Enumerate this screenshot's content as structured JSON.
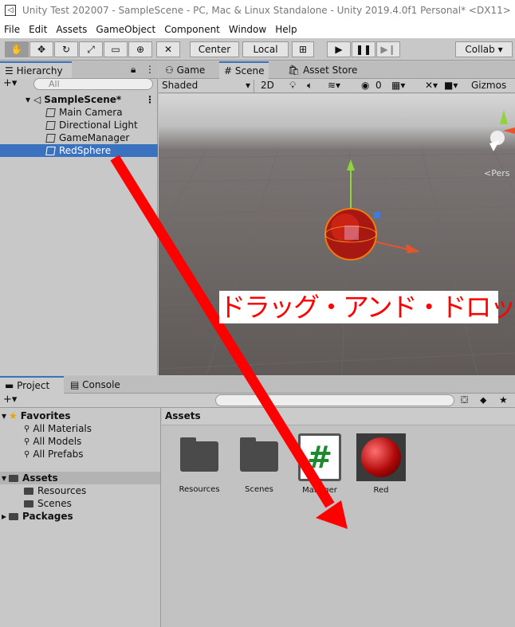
{
  "window": {
    "title": "Unity Test 202007 - SampleScene - PC, Mac & Linux Standalone - Unity 2019.4.0f1 Personal* <DX11>"
  },
  "menu": [
    "File",
    "Edit",
    "Assets",
    "GameObject",
    "Component",
    "Window",
    "Help"
  ],
  "toolbar": {
    "center_label": "Center",
    "local_label": "Local",
    "collab_label": "Collab ▾"
  },
  "hierarchy": {
    "tab_label": "Hierarchy",
    "search_placeholder": "All",
    "scene": "SampleScene*",
    "items": [
      "Main Camera",
      "Directional Light",
      "GameManager",
      "RedSphere"
    ],
    "selected": "RedSphere"
  },
  "scene_view": {
    "tabs": [
      "Game",
      "Scene",
      "Asset Store"
    ],
    "active_tab": "Scene",
    "shading_mode": "Shaded",
    "mode_2d": "2D",
    "hidden_count": "0",
    "gizmos_label": "Gizmos",
    "persp_label": "<Pers"
  },
  "annotation": {
    "text": "ドラッグ・アンド・ドロップ",
    "arrow_color": "#ff0000"
  },
  "project": {
    "tabs": [
      "Project",
      "Console"
    ],
    "favorites_label": "Favorites",
    "favorites": [
      "All Materials",
      "All Models",
      "All Prefabs"
    ],
    "assets_label": "Assets",
    "asset_folders": [
      "Resources",
      "Scenes"
    ],
    "packages_label": "Packages",
    "assets_header": "Assets",
    "asset_items": [
      "Resources",
      "Scenes",
      "Manager",
      "Red"
    ]
  },
  "colors": {
    "selection": "#3a72c0",
    "scene_ground": "#5f5a58",
    "sphere": "#c8140f"
  }
}
